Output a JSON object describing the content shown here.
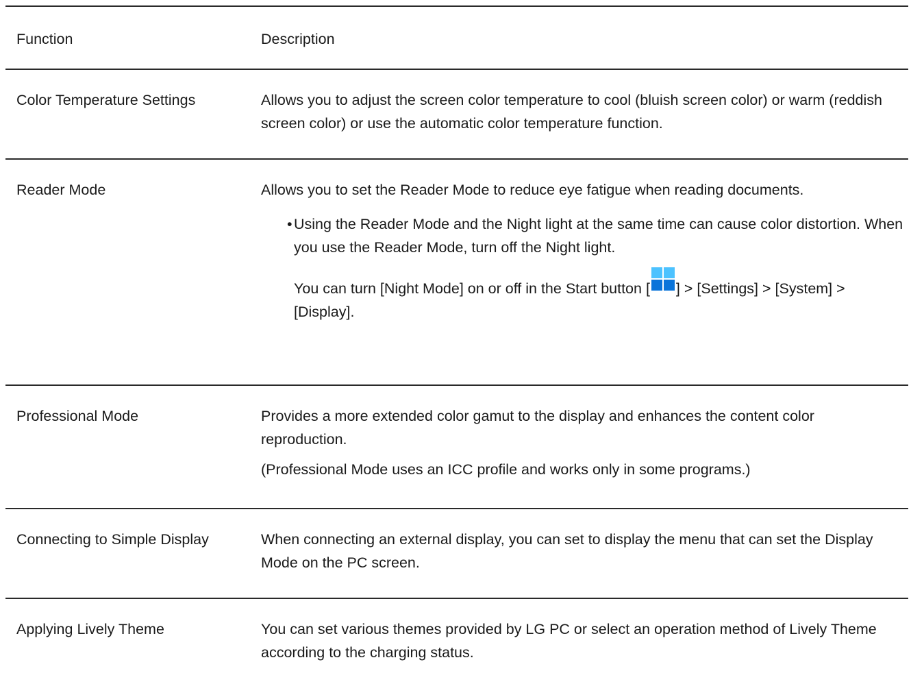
{
  "header": {
    "function": "Function",
    "description": "Description"
  },
  "rows": [
    {
      "function": "Color Temperature Settings",
      "description": "Allows you to adjust the screen color temperature to cool (bluish screen color) or warm (reddish screen color) or use the automatic color temperature function."
    },
    {
      "function": "Reader Mode",
      "description": "Allows you to set the Reader Mode to reduce eye fatigue when reading documents.",
      "bullet_marker": "•",
      "bullet": "Using the Reader Mode and the Night light at the same time can cause color distortion. When you use the Reader Mode, turn off the Night light.",
      "note_before_icon": "You can turn [Night Mode] on or off in the Start button [",
      "note_icon": "windows-start-icon",
      "note_after_icon": "] > [Settings] > [System] > [Display]."
    },
    {
      "function": "Professional Mode",
      "description": "Provides a more extended color gamut to the display and enhances the content color reproduction.",
      "note": "(Professional Mode uses an ICC profile and works only in some programs.)"
    },
    {
      "function": "Connecting to Simple Display",
      "description": "When connecting an external display, you can set to display the menu that can set the Display Mode on the PC screen."
    },
    {
      "function": "Applying Lively Theme",
      "description": "You can set various themes provided by LG PC or select an operation method of Lively Theme according to the charging status."
    }
  ],
  "colors": {
    "text": "#1a1a1a",
    "rule": "#2a2a2a",
    "icon_light": "#4cc2ff",
    "icon_dark": "#0a74da"
  }
}
